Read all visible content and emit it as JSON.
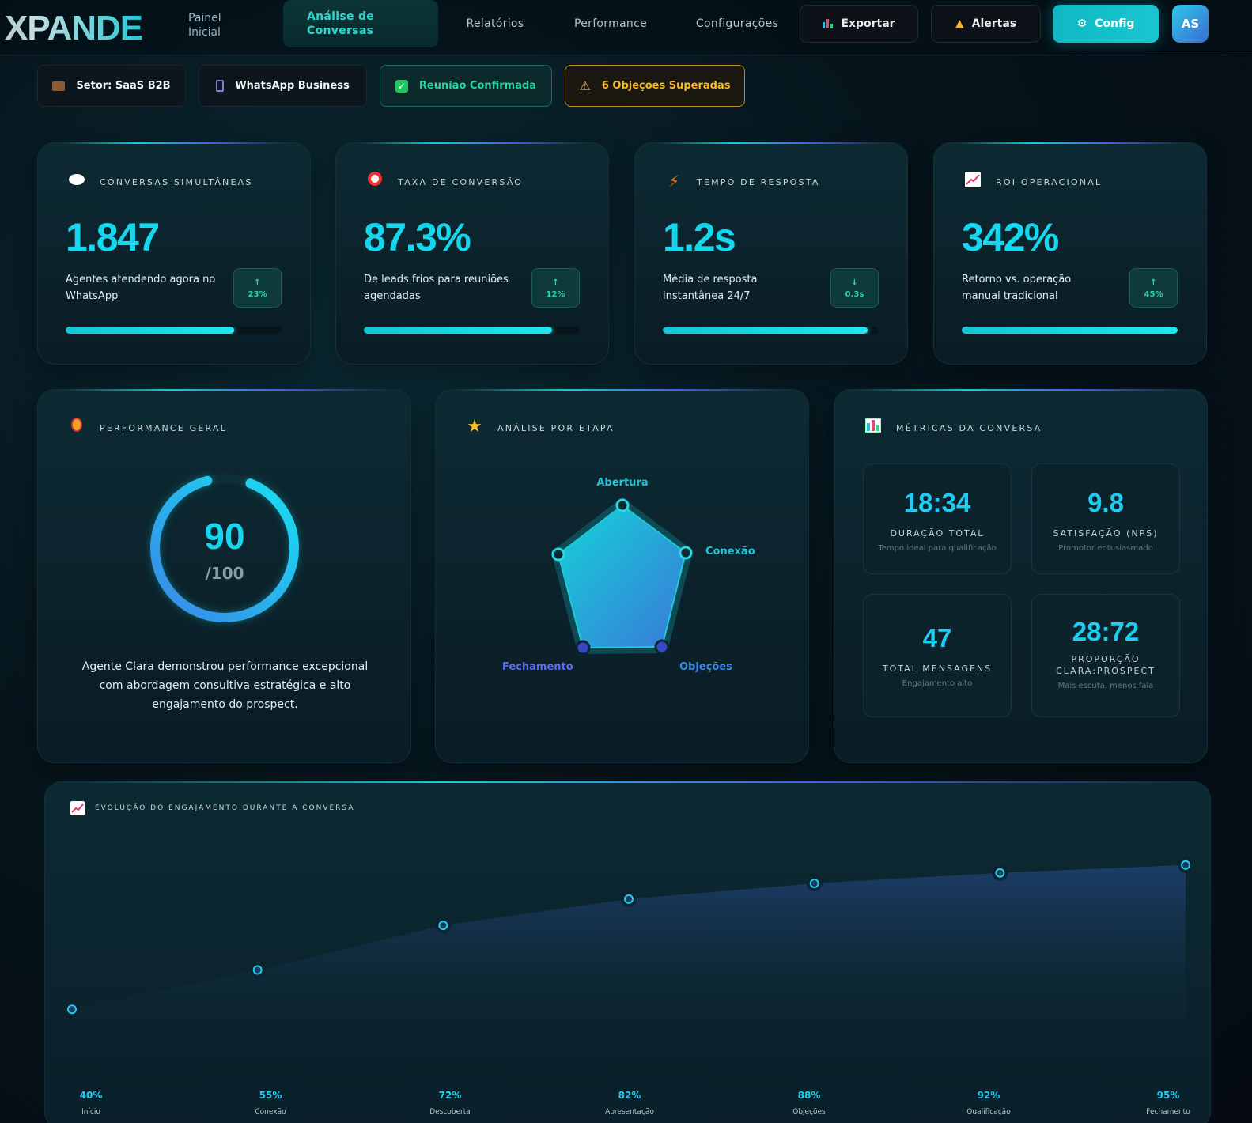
{
  "header": {
    "logo_x": "X",
    "logo_rest": "PANDE",
    "logo_sub": "Painel Inicial",
    "nav": [
      "Análise de Conversas",
      "Relatórios",
      "Performance",
      "Configurações"
    ],
    "export_label": "Exportar",
    "alerts_label": "Alertas",
    "config_label": "Config",
    "avatar_initials": "AS"
  },
  "chips": [
    {
      "icon": "briefcase-icon",
      "label": "Setor: SaaS B2B"
    },
    {
      "icon": "phone-icon",
      "label": "WhatsApp Business"
    },
    {
      "icon": "check-icon",
      "label": "Reunião Confirmada"
    },
    {
      "icon": "warning-icon",
      "label": "6 Objeções Superadas"
    }
  ],
  "kpis": [
    {
      "icon": "chat-icon",
      "title": "CONVERSAS SIMULTÂNEAS",
      "value": "1.847",
      "desc": "Agentes atendendo agora no WhatsApp",
      "trend": "↑",
      "delta": "23%",
      "progress": 0.78
    },
    {
      "icon": "target-icon",
      "title": "TAXA DE CONVERSÃO",
      "value": "87.3%",
      "desc": "De leads frios para reuniões agendadas",
      "trend": "↑",
      "delta": "12%",
      "progress": 0.873
    },
    {
      "icon": "bolt-icon",
      "title": "TEMPO DE RESPOSTA",
      "value": "1.2s",
      "desc": "Média de resposta instantânea 24/7",
      "trend": "↓",
      "delta": "0.3s",
      "progress": 0.95
    },
    {
      "icon": "chart-up-icon",
      "title": "ROI OPERACIONAL",
      "value": "342%",
      "desc": "Retorno vs. operação manual tradicional",
      "trend": "↑",
      "delta": "45%",
      "progress": 1.0
    }
  ],
  "performance": {
    "title": "PERFORMANCE GERAL",
    "score": "90",
    "max": "/100",
    "score_value": 90,
    "description": "Agente Clara demonstrou performance excepcional com abordagem consultiva estratégica e alto engajamento do prospect."
  },
  "stages": {
    "title": "ANÁLISE POR ETAPA",
    "labels": [
      "Abertura",
      "Conexão",
      "Objeções",
      "Fechamento"
    ]
  },
  "metrics": {
    "title": "MÉTRICAS DA CONVERSA",
    "items": [
      {
        "value": "18:34",
        "label": "DURAÇÃO TOTAL",
        "sub": "Tempo ideal para qualificação"
      },
      {
        "value": "9.8",
        "label": "SATISFAÇÃO (NPS)",
        "sub": "Promotor entusiasmado"
      },
      {
        "value": "47",
        "label": "TOTAL MENSAGENS",
        "sub": "Engajamento alto"
      },
      {
        "value": "28:72",
        "label": "PROPORÇÃO CLARA:PROSPECT",
        "sub": "Mais escuta, menos fala"
      }
    ]
  },
  "engagement": {
    "title": "EVOLUÇÃO DO ENGAJAMENTO DURANTE A CONVERSA"
  },
  "chart_data": {
    "type": "area",
    "categories": [
      "Início",
      "Conexão",
      "Descoberta",
      "Apresentação",
      "Objeções",
      "Qualificação",
      "Fechamento"
    ],
    "values": [
      40,
      55,
      72,
      82,
      88,
      92,
      95
    ],
    "value_labels": [
      "40%",
      "55%",
      "72%",
      "82%",
      "88%",
      "92%",
      "95%"
    ],
    "ylim": [
      0,
      110
    ],
    "grid": false
  },
  "colors": {
    "accent": "#16d6ee",
    "secondary": "#4a5de0",
    "success": "#27d3a5",
    "warning": "#f3b82b"
  }
}
